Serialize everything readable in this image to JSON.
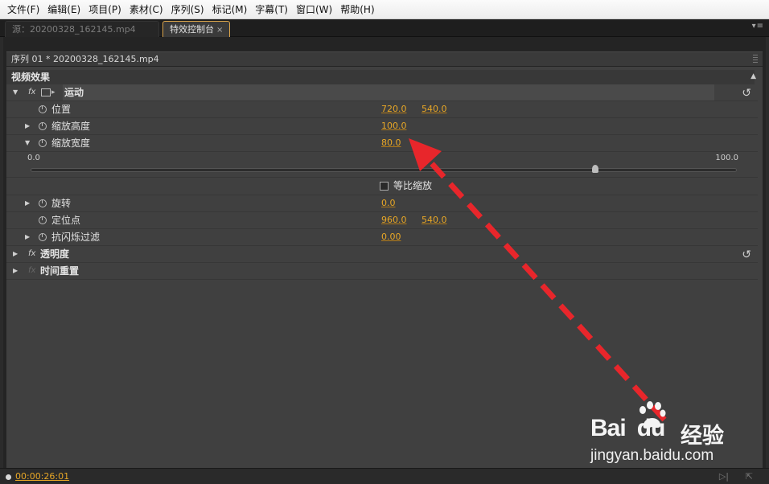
{
  "menu": [
    "文件(F)",
    "编辑(E)",
    "项目(P)",
    "素材(C)",
    "序列(S)",
    "标记(M)",
    "字幕(T)",
    "窗口(W)",
    "帮助(H)"
  ],
  "tabs": {
    "source": "源：20200328_162145.mp4",
    "effect_controls": "特效控制台",
    "close_glyph": "×",
    "menu_glyph": "▾≡"
  },
  "sequence_label": "序列 01 * 20200328_162145.mp4",
  "section_title": "视频效果",
  "motion": {
    "name": "运动",
    "position": {
      "label": "位置",
      "x": "720.0",
      "y": "540.0"
    },
    "scale_height": {
      "label": "缩放高度",
      "value": "100.0"
    },
    "scale_width": {
      "label": "缩放宽度",
      "value": "80.0",
      "slider_min": "0.0",
      "slider_max": "100.0",
      "slider_fraction": 0.8
    },
    "uniform_scale": {
      "label": "等比缩放",
      "checked": false
    },
    "rotation": {
      "label": "旋转",
      "value": "0.0"
    },
    "anchor_point": {
      "label": "定位点",
      "x": "960.0",
      "y": "540.0"
    },
    "anti_flicker": {
      "label": "抗闪烁过滤",
      "value": "0.00"
    }
  },
  "opacity": {
    "name": "透明度"
  },
  "time_remap": {
    "name": "时间重置"
  },
  "timecode": "00:00:26:01",
  "fx_label": "fx",
  "reset_glyph": "↺",
  "watermark": {
    "brand_bai": "Bai",
    "brand_du": "du",
    "brand_jy": "经验",
    "url": "jingyan.baidu.com"
  },
  "colors": {
    "accent_value": "#e8a726",
    "arrow": "#e8262b",
    "panel_bg": "#404040"
  },
  "icons": {
    "stopwatch": "stopwatch-icon",
    "reset": "reset-icon",
    "transform": "transform-icon"
  }
}
